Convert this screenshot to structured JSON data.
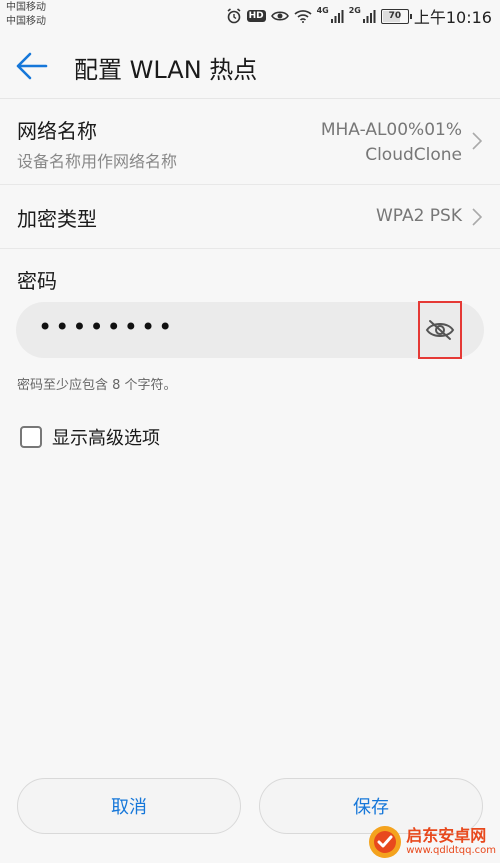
{
  "status_bar": {
    "carrier_1": "中国移动",
    "carrier_2": "中国移动",
    "hd": "HD",
    "net_1": "4G",
    "net_2": "2G",
    "battery": "70",
    "battery_level": 0.7,
    "time": "上午10:16"
  },
  "app_bar": {
    "title": "配置 WLAN 热点"
  },
  "network": {
    "title": "网络名称",
    "subtitle": "设备名称用作网络名称",
    "value_line1": "MHA-AL00%01%",
    "value_line2": "CloudClone"
  },
  "security": {
    "title": "加密类型",
    "value": "WPA2 PSK"
  },
  "password": {
    "label": "密码",
    "value": "••••••••",
    "hint": "密码至少应包含 8 个字符。"
  },
  "advanced": {
    "label": "显示高级选项",
    "checked": false
  },
  "buttons": {
    "cancel": "取消",
    "save": "保存"
  },
  "watermark": {
    "name": "启东安卓网",
    "url": "www.qdldtqq.com"
  },
  "colors": {
    "accent": "#1677d9",
    "highlight": "#e53935",
    "watermark": "#e8491d"
  }
}
